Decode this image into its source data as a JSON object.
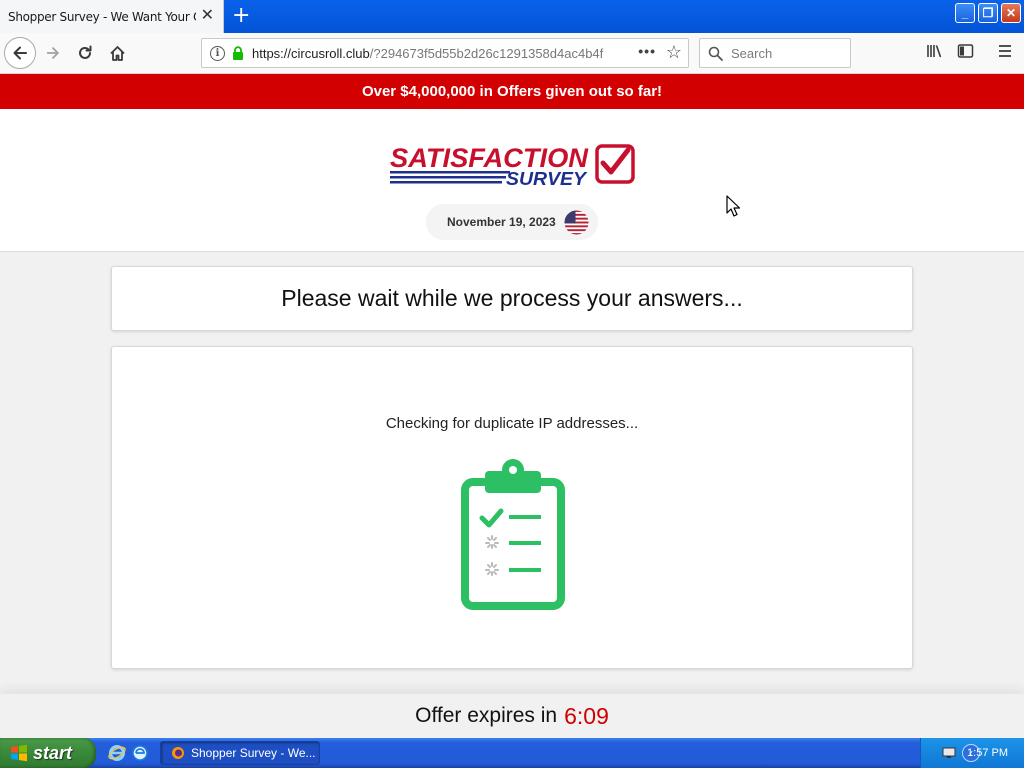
{
  "browser": {
    "tab_title": "Shopper Survey - We Want Your Opinion",
    "url_host": "https://circusroll.club",
    "url_path": "/?294673f5d55b2d26c1291358d4ac4b4f",
    "search_placeholder": "Search"
  },
  "page": {
    "banner_text": "Over $4,000,000 in Offers given out so far!",
    "logo_line1": "SATISFACTION",
    "logo_line2": "SURVEY",
    "date": "November 19, 2023",
    "title": "Please wait while we process your answers...",
    "status": "Checking for duplicate IP addresses...",
    "offer_label": "Offer expires in",
    "offer_timer": "6:09"
  },
  "taskbar": {
    "start_label": "start",
    "task_label": "Shopper Survey - We...",
    "clock": "1:57 PM"
  },
  "colors": {
    "banner_red": "#d20000",
    "accent_green": "#2dbf63",
    "xp_blue": "#245edb"
  }
}
